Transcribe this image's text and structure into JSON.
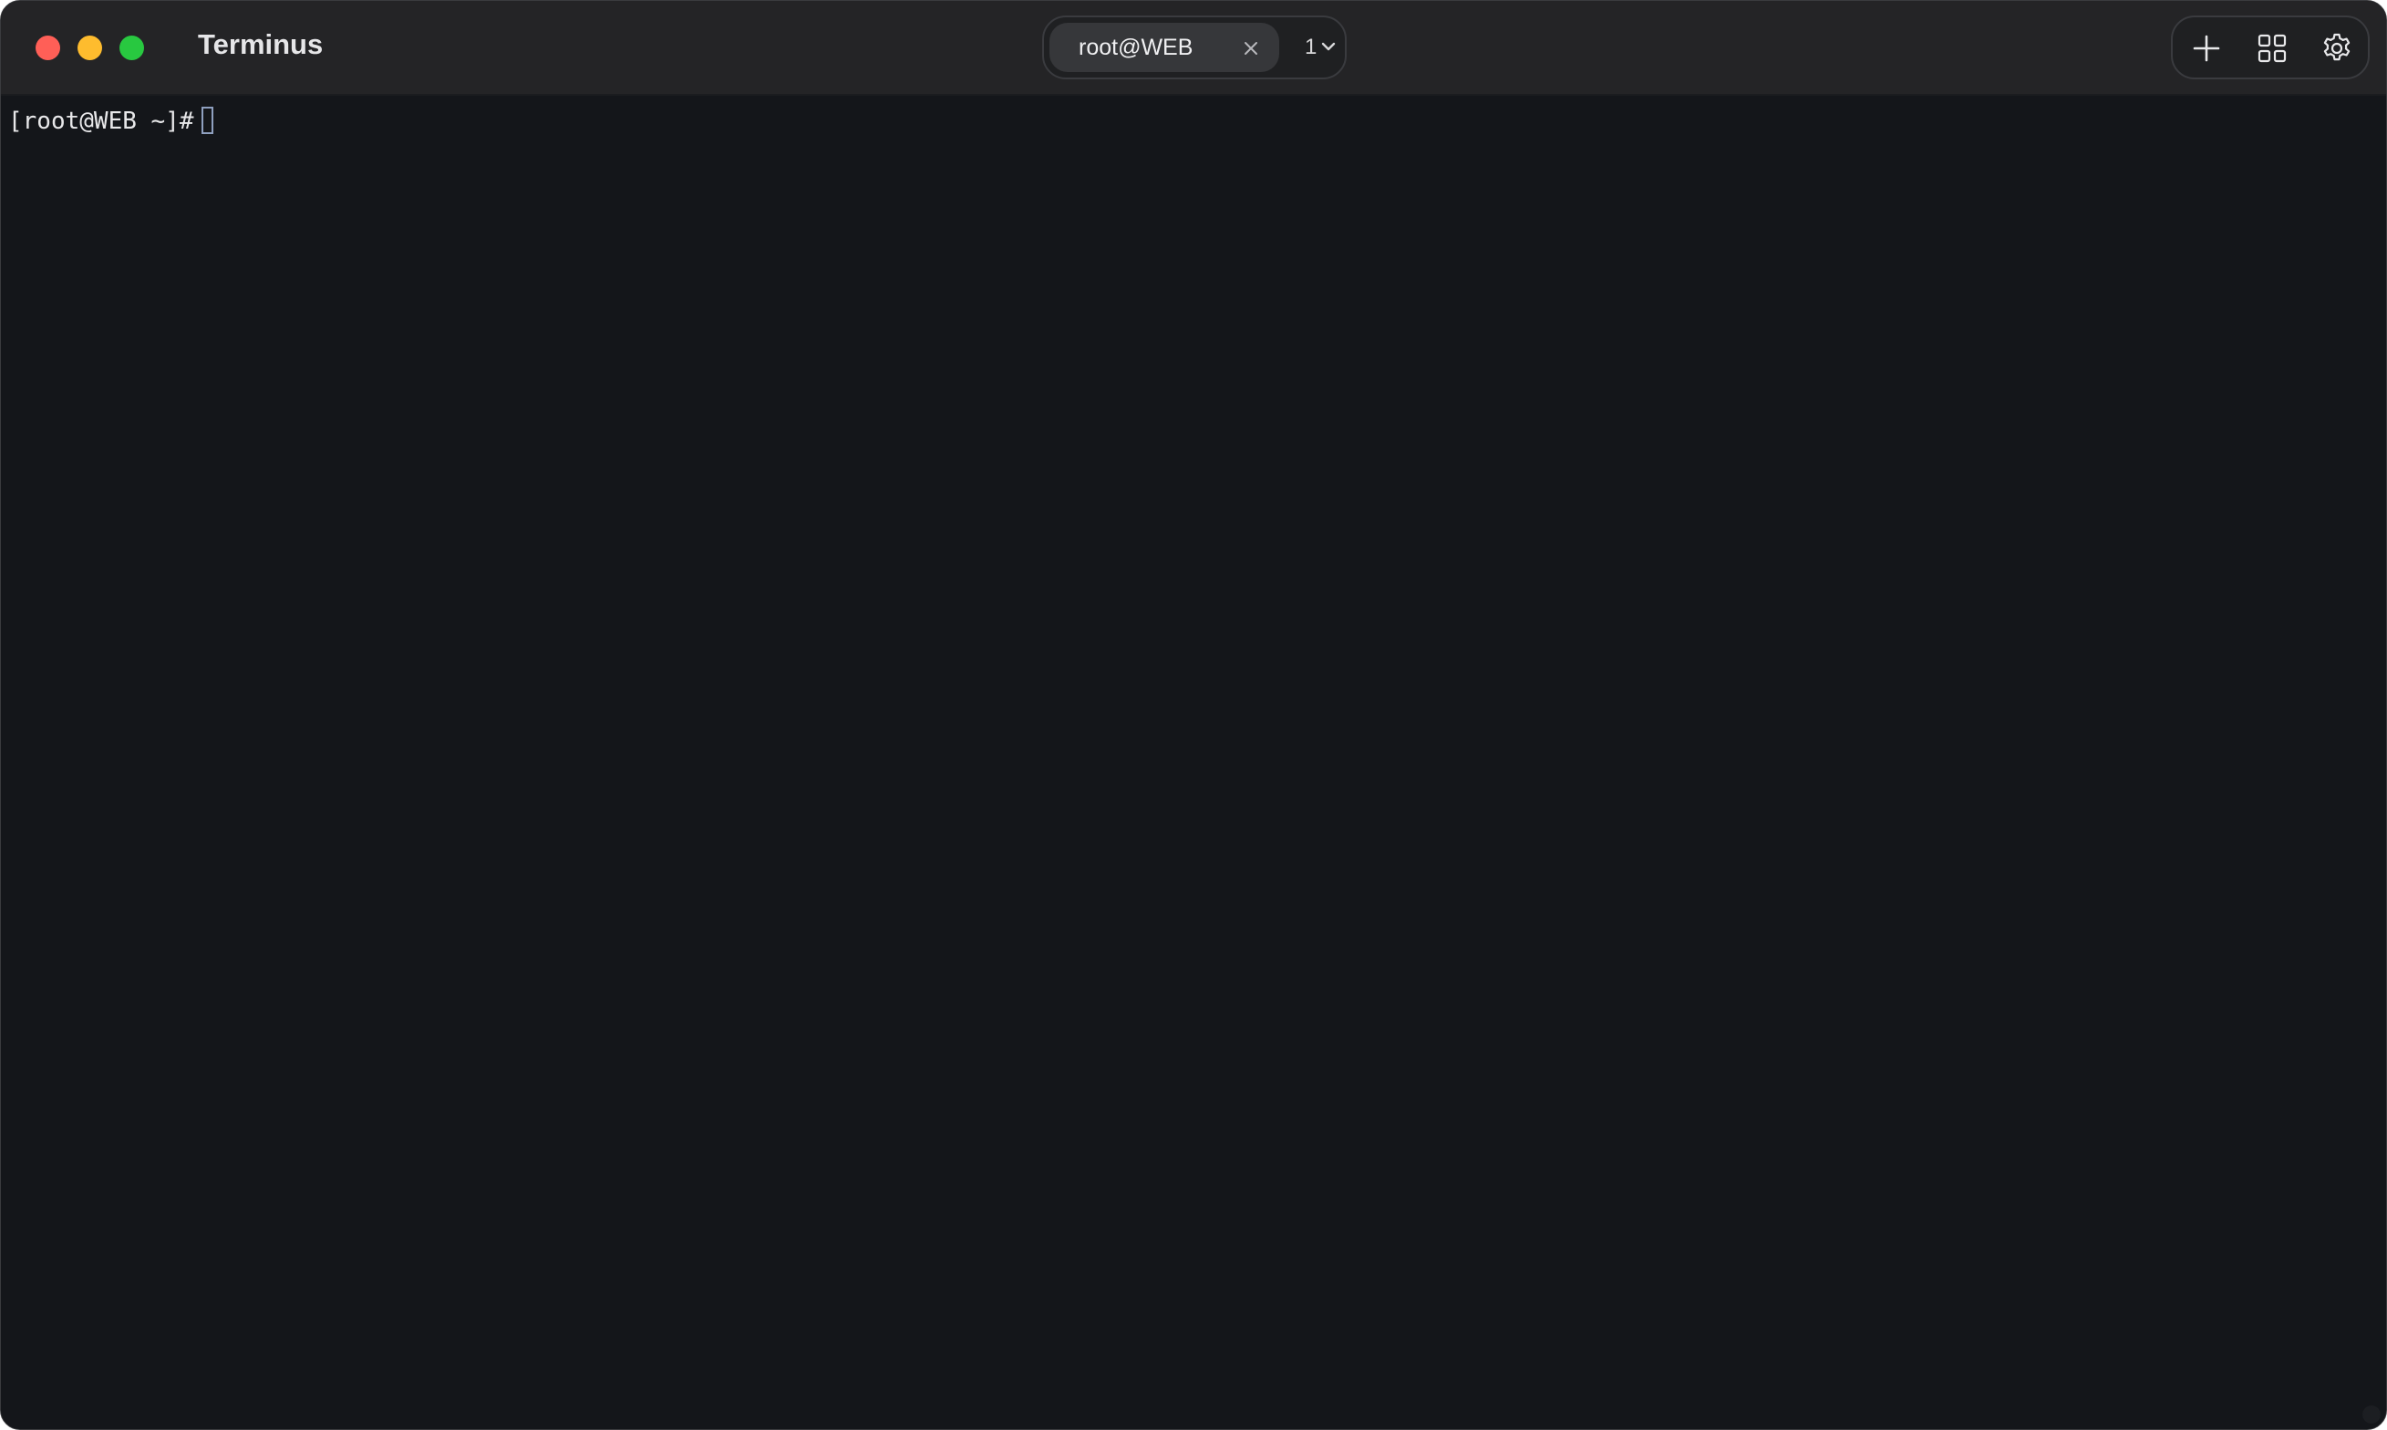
{
  "window": {
    "title": "Terminus",
    "controls": {
      "close": "#ff5f57",
      "minimize": "#febc2e",
      "maximize": "#28c840"
    }
  },
  "tabs": {
    "active_label": "root@WEB",
    "close_icon": "close-icon",
    "count": "1",
    "count_icon": "chevron-down-icon"
  },
  "toolbar": {
    "icons": [
      "plus-icon",
      "grid-icon",
      "gear-icon"
    ]
  },
  "terminal": {
    "prompt": "[root@WEB ~]#",
    "input": ""
  }
}
